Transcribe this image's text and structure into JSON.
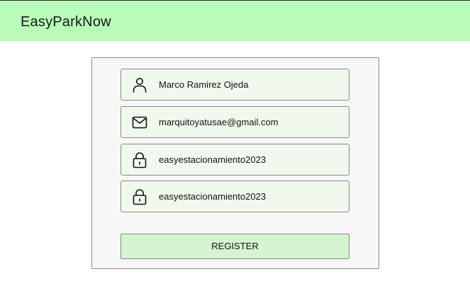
{
  "header": {
    "title": "EasyParkNow",
    "background": "#b9fbb9"
  },
  "form": {
    "fields": [
      {
        "icon": "user-icon",
        "value": "Marco Ramirez Ojeda"
      },
      {
        "icon": "mail-icon",
        "value": "marquitoyatusae@gmail.com"
      },
      {
        "icon": "lock-icon",
        "value": "easyestacionamiento2023"
      },
      {
        "icon": "lock-icon",
        "value": "easyestacionamiento2023"
      }
    ],
    "register_label": "REGISTER",
    "register_color": "#d4f5d0",
    "field_color": "#f1f9ee"
  }
}
